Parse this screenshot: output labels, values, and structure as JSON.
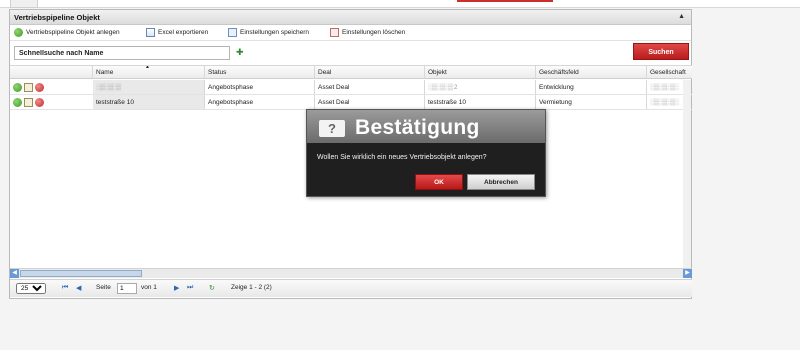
{
  "window": {
    "title": "Vertriebspipeline Objekt",
    "collapse_glyph": "▲"
  },
  "toolbar": {
    "new_label": "Vertriebspipeline Objekt anlegen",
    "export_label": "Excel exportieren",
    "save_settings_label": "Einstellungen speichern",
    "delete_settings_label": "Einstellungen löschen",
    "icons": [
      "add-circle-icon",
      "excel-icon",
      "save-settings-icon",
      "delete-settings-icon"
    ]
  },
  "search": {
    "value": "Schnellsuche nach Name",
    "button_label": "Suchen"
  },
  "grid": {
    "columns": [
      "Name",
      "Status",
      "Deal",
      "Objekt",
      "Geschäftsfeld",
      "Gesellschaft"
    ],
    "sort_indicator": "▲",
    "rows": [
      {
        "name": "░▒░▒░▒",
        "status": "Angebotsphase",
        "deal": "Asset Deal",
        "objekt": "░▒░▒░▒ 2",
        "geschaeftsfeld": "Entwicklung",
        "gesellschaft": "░▒░▒░▒░"
      },
      {
        "name": "teststraße 10",
        "status": "Angebotsphase",
        "deal": "Asset Deal",
        "objekt": "teststraße 10",
        "geschaeftsfeld": "Vermietung",
        "gesellschaft": "░▒░▒░▒░"
      }
    ]
  },
  "pager": {
    "page_size": "25",
    "page_label": "Seite",
    "page_value": "1",
    "of_label": "von 1",
    "summary": "Zeige 1 - 2 (2)",
    "first": "⏮",
    "prev": "◀",
    "next": "▶",
    "last": "⏭",
    "refresh": "↻"
  },
  "dialog": {
    "title": "Bestätigung",
    "icon": "?",
    "message": "Wollen Sie wirklich ein neues Vertriebsobjekt anlegen?",
    "ok_label": "OK",
    "cancel_label": "Abbrechen"
  },
  "colors": {
    "accent_red": "#c9302c",
    "dialog_bg": "#1f1f1f",
    "dialog_header": "#8a8a8a"
  }
}
